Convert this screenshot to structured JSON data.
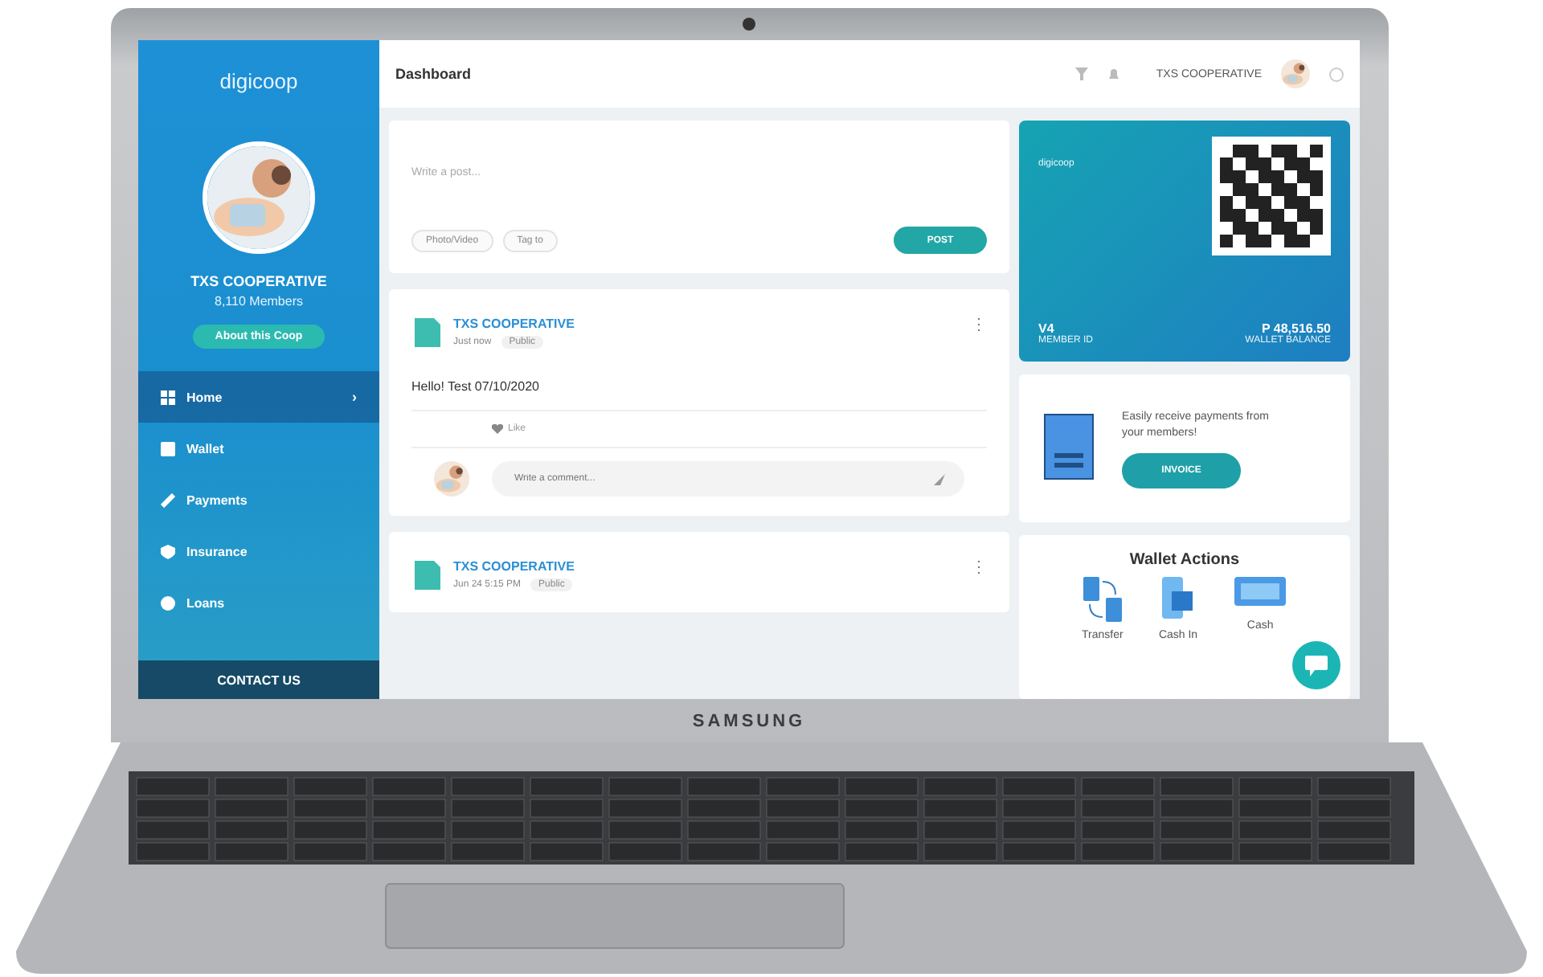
{
  "device": {
    "brand": "SAMSUNG"
  },
  "sidebar": {
    "logo": "digicoop",
    "name": "TXS COOPERATIVE",
    "members": "8,110 Members",
    "about_button": "About this Coop",
    "items": [
      {
        "label": "Home",
        "selected": true,
        "chevron": "›"
      },
      {
        "label": "Wallet",
        "selected": false
      },
      {
        "label": "Payments",
        "selected": false
      },
      {
        "label": "Insurance",
        "selected": false
      },
      {
        "label": "Loans",
        "selected": false
      }
    ],
    "contact": "CONTACT US"
  },
  "topbar": {
    "title": "Dashboard",
    "user": "TXS COOPERATIVE"
  },
  "composer": {
    "placeholder": "Write a post...",
    "chips": [
      "Photo/Video",
      "Tag to"
    ],
    "post_button": "POST"
  },
  "posts": [
    {
      "author": "TXS COOPERATIVE",
      "time": "Just now",
      "audience": "Public",
      "menu": "⋮",
      "text": "Hello! Test 07/10/2020",
      "like": "Like",
      "comment_placeholder": "Write a comment..."
    },
    {
      "author": "TXS COOPERATIVE",
      "time": "Jun 24 5:15 PM",
      "audience": "Public",
      "menu": "⋮"
    }
  ],
  "card": {
    "logo": "digicoop",
    "left_title": "V4",
    "left_sub": "MEMBER ID",
    "right_title": "P 48,516.50",
    "right_sub": "WALLET BALANCE"
  },
  "invoice": {
    "text": "Easily receive payments from your members!",
    "button": "INVOICE"
  },
  "wallet_actions": {
    "title": "Wallet Actions",
    "actions": [
      {
        "label": "Transfer"
      },
      {
        "label": "Cash In"
      },
      {
        "label": "Cash"
      }
    ]
  }
}
